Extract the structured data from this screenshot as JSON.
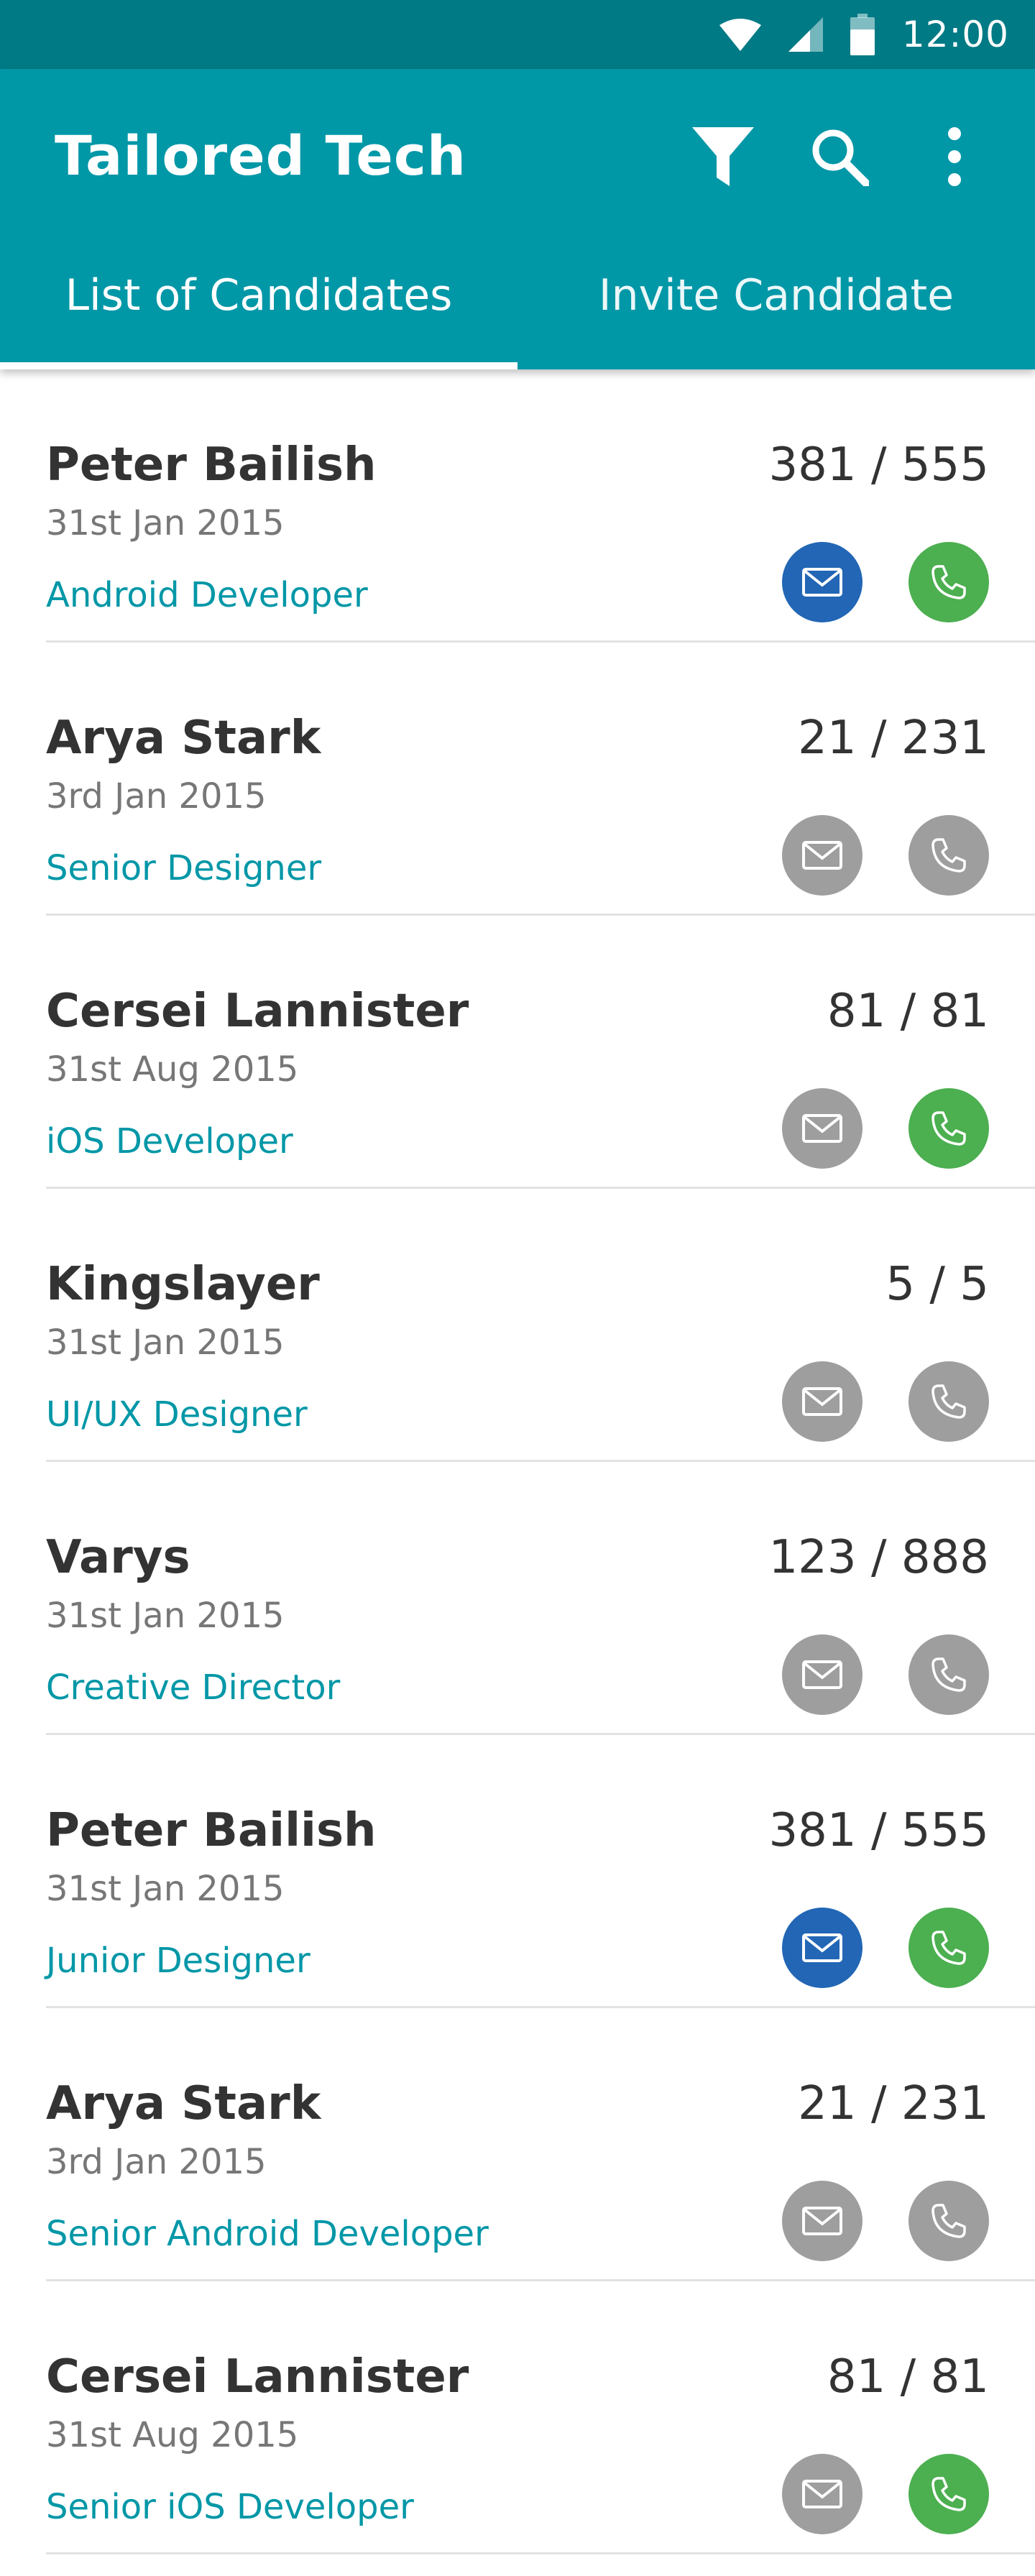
{
  "status_bar": {
    "time": "12:00",
    "icons": [
      "wifi-icon",
      "signal-icon",
      "battery-icon"
    ]
  },
  "app_bar": {
    "title": "Tailored Tech",
    "actions": [
      "filter-icon",
      "search-icon",
      "more-vert-icon"
    ],
    "tabs": [
      {
        "label": "List of Candidates",
        "active": true
      },
      {
        "label": "Invite Candidate",
        "active": false
      }
    ]
  },
  "colors": {
    "primary": "#0097a7",
    "primary_dark": "#007a85",
    "mail_active": "#2266b5",
    "phone_active": "#4caf50",
    "inactive": "#9e9e9e"
  },
  "candidates": [
    {
      "name": "Peter Bailish",
      "date": "31st Jan 2015",
      "role": "Android Developer",
      "score": "381 / 555",
      "mail_active": true,
      "phone_active": true
    },
    {
      "name": "Arya Stark",
      "date": "3rd Jan 2015",
      "role": "Senior Designer",
      "score": "21 / 231",
      "mail_active": false,
      "phone_active": false
    },
    {
      "name": "Cersei Lannister",
      "date": "31st Aug 2015",
      "role": "iOS Developer",
      "score": "81 / 81",
      "mail_active": false,
      "phone_active": true
    },
    {
      "name": "Kingslayer",
      "date": "31st Jan 2015",
      "role": "UI/UX Designer",
      "score": "5 / 5",
      "mail_active": false,
      "phone_active": false
    },
    {
      "name": "Varys",
      "date": "31st Jan 2015",
      "role": "Creative Director",
      "score": "123 / 888",
      "mail_active": false,
      "phone_active": false
    },
    {
      "name": "Peter Bailish",
      "date": "31st Jan 2015",
      "role": "Junior Designer",
      "score": "381 / 555",
      "mail_active": true,
      "phone_active": true
    },
    {
      "name": "Arya Stark",
      "date": "3rd Jan 2015",
      "role": "Senior Android Developer",
      "score": "21 / 231",
      "mail_active": false,
      "phone_active": false
    },
    {
      "name": "Cersei Lannister",
      "date": "31st Aug 2015",
      "role": "Senior iOS Developer",
      "score": "81 / 81",
      "mail_active": false,
      "phone_active": true
    }
  ]
}
